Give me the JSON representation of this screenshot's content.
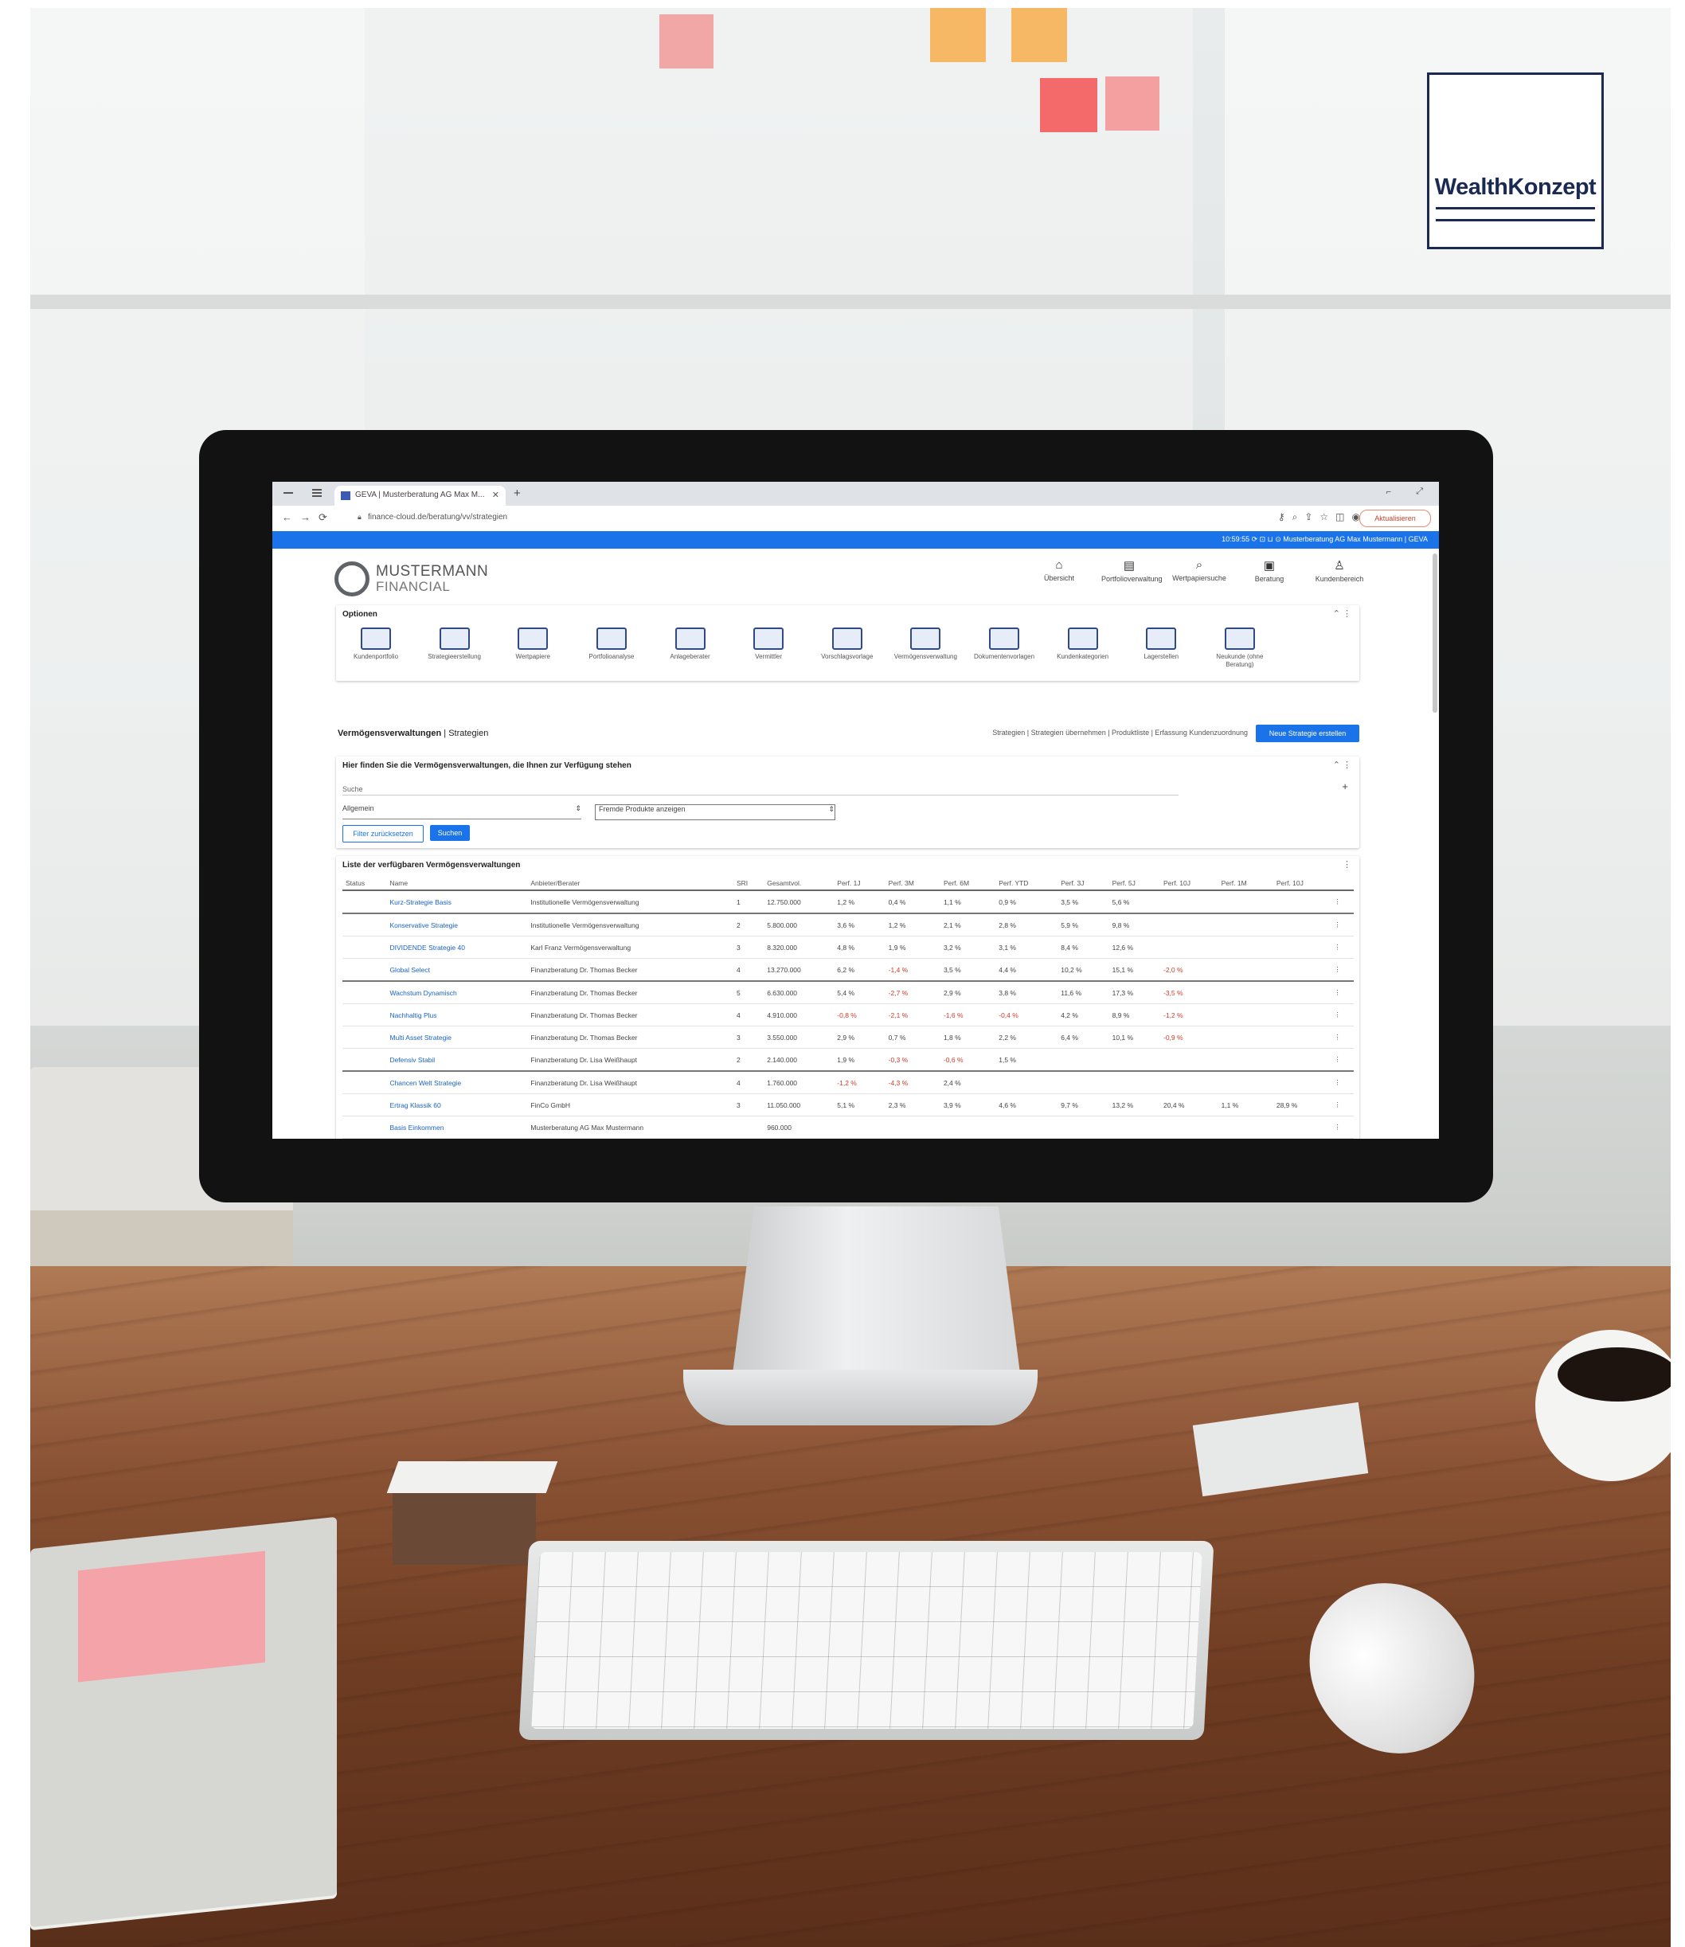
{
  "brand_logo": {
    "text": "WealthKonzept"
  },
  "browser": {
    "tab_title": "GEVA | Musterberatung AG Max M...",
    "url": "finance-cloud.de/beratung/vv/strategien",
    "update_button": "Aktualisieren"
  },
  "status_bar": {
    "text": "10:59:55  ⟳  ⊡  ⊔  ⊙  Musterberatung AG Max Mustermann  |  GEVA"
  },
  "app": {
    "name_line1": "MUSTERMANN",
    "name_line2": "FINANCIAL",
    "nav": [
      {
        "label": "Übersicht",
        "icon": "home-icon"
      },
      {
        "label": "Portfolioverwaltung",
        "icon": "portfolio-icon"
      },
      {
        "label": "Wertpapiersuche",
        "icon": "search-icon"
      },
      {
        "label": "Beratung",
        "icon": "briefcase-icon"
      },
      {
        "label": "Kundenbereich",
        "icon": "user-icon"
      }
    ]
  },
  "options": {
    "title": "Optionen",
    "items": [
      "Kundenportfolio",
      "Strategieerstellung",
      "Wertpapiere",
      "Portfolioanalyse",
      "Anlageberater",
      "Vermittler",
      "Vorschlagsvorlage",
      "Vermögensverwaltung",
      "Dokumentenvorlagen",
      "Kundenkategorien",
      "Lagerstellen",
      "Neukunde (ohne Beratung)"
    ]
  },
  "section": {
    "title": "Vermögensverwaltungen",
    "subtitle": "Strategien",
    "links": "Strategien | Strategien übernehmen | Produktliste | Erfassung Kundenzuordnung",
    "new_button": "Neue Strategie erstellen"
  },
  "filter": {
    "title": "Hier finden Sie die Vermögensverwaltungen, die Ihnen zur Verfügung stehen",
    "search_placeholder": "Suche",
    "category_value": "Allgemein",
    "product_value": "Fremde Produkte anzeigen",
    "reset_button": "Filter zurücksetzen",
    "search_button": "Suchen"
  },
  "list": {
    "title": "Liste der verfügbaren Vermögensverwaltungen",
    "columns": [
      "Status",
      "Name",
      "Anbieter/Berater",
      "SRI",
      "Gesamtvol.",
      "Perf. 1J",
      "Perf. 3M",
      "Perf. 6M",
      "Perf. YTD",
      "Perf. 3J",
      "Perf. 5J",
      "Perf. 10J",
      "Perf. 1M",
      "Perf. 10J"
    ],
    "rows": [
      {
        "name": "Kurz-Strategie Basis",
        "provider": "Institutionelle Vermögensverwaltung",
        "sri": "1",
        "vol": "12.750.000",
        "v": [
          "1,2 %",
          "0,4 %",
          "1,1 %",
          "0,9 %",
          "3,5 %",
          "5,6 %",
          "",
          "",
          ""
        ],
        "neg": []
      },
      {
        "name": "Konservative Strategie",
        "provider": "Institutionelle Vermögensverwaltung",
        "sri": "2",
        "vol": "5.800.000",
        "v": [
          "3,6 %",
          "1,2 %",
          "2,1 %",
          "2,8 %",
          "5,9 %",
          "9,8 %",
          "",
          "",
          ""
        ],
        "neg": []
      },
      {
        "name": "DIVIDENDE Strategie 40",
        "provider": "Karl Franz Vermögensverwaltung",
        "sri": "3",
        "vol": "8.320.000",
        "v": [
          "4,8 %",
          "1,9 %",
          "3,2 %",
          "3,1 %",
          "8,4 %",
          "12,6 %",
          "",
          "",
          ""
        ],
        "neg": []
      },
      {
        "name": "Global Select",
        "provider": "Finanzberatung Dr. Thomas Becker",
        "sri": "4",
        "vol": "13.270.000",
        "v": [
          "6,2 %",
          "-1,4 %",
          "3,5 %",
          "4,4 %",
          "10,2 %",
          "15,1 %",
          "-2,0 %",
          "",
          ""
        ],
        "neg": [
          1,
          6
        ]
      },
      {
        "name": "Wachstum Dynamisch",
        "provider": "Finanzberatung Dr. Thomas Becker",
        "sri": "5",
        "vol": "6.630.000",
        "v": [
          "5,4 %",
          "-2,7 %",
          "2,9 %",
          "3,8 %",
          "11,6 %",
          "17,3 %",
          "-3,5 %",
          "",
          ""
        ],
        "neg": [
          1,
          6
        ]
      },
      {
        "name": "Nachhaltig Plus",
        "provider": "Finanzberatung Dr. Thomas Becker",
        "sri": "4",
        "vol": "4.910.000",
        "v": [
          "-0,8 %",
          "-2,1 %",
          "-1,6 %",
          "-0,4 %",
          "4,2 %",
          "8,9 %",
          "-1,2 %",
          "",
          ""
        ],
        "neg": [
          0,
          1,
          2,
          3,
          6
        ]
      },
      {
        "name": "Multi Asset Strategie",
        "provider": "Finanzberatung Dr. Thomas Becker",
        "sri": "3",
        "vol": "3.550.000",
        "v": [
          "2,9 %",
          "0,7 %",
          "1,8 %",
          "2,2 %",
          "6,4 %",
          "10,1 %",
          "-0,9 %",
          "",
          ""
        ],
        "neg": [
          6
        ]
      },
      {
        "name": "Defensiv Stabil",
        "provider": "Finanzberatung Dr. Lisa Weißhaupt",
        "sri": "2",
        "vol": "2.140.000",
        "v": [
          "1,9 %",
          "-0,3 %",
          "-0,6 %",
          "1,5 %",
          "",
          "",
          "",
          "",
          ""
        ],
        "neg": [
          1,
          2
        ]
      },
      {
        "name": "Chancen Welt Strategie",
        "provider": "Finanzberatung Dr. Lisa Weißhaupt",
        "sri": "4",
        "vol": "1.760.000",
        "v": [
          "-1,2 %",
          "-4,3 %",
          "2,4 %",
          "",
          "",
          "",
          "",
          "",
          ""
        ],
        "neg": [
          0,
          1
        ]
      },
      {
        "name": "Ertrag Klassik 60",
        "provider": "FinCo GmbH",
        "sri": "3",
        "vol": "11.050.000",
        "v": [
          "5,1 %",
          "2,3 %",
          "3,9 %",
          "4,6 %",
          "9,7 %",
          "13,2 %",
          "20,4 %",
          "1,1 %",
          "28,9 %"
        ],
        "neg": []
      },
      {
        "name": "Basis Einkommen",
        "provider": "Musterberatung AG Max Mustermann",
        "sri": "",
        "vol": "960.000",
        "v": [
          "",
          "",
          "",
          "",
          "",
          "",
          "",
          "",
          ""
        ],
        "neg": []
      }
    ]
  }
}
